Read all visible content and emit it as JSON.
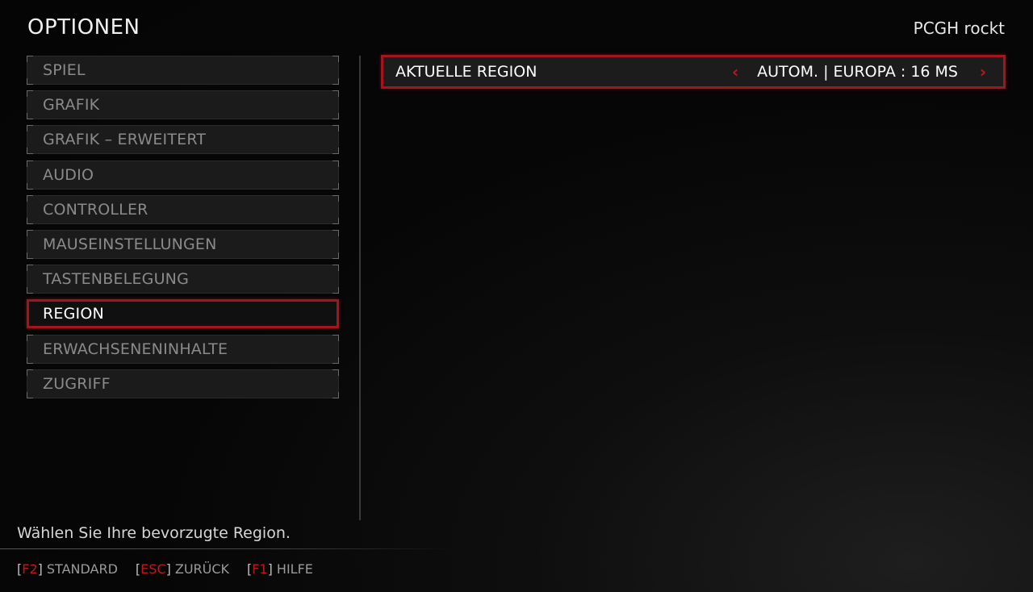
{
  "header": {
    "title": "OPTIONEN",
    "user": "PCGH rockt"
  },
  "menu": {
    "items": [
      {
        "label": "SPIEL",
        "active": false
      },
      {
        "label": "GRAFIK",
        "active": false
      },
      {
        "label": "GRAFIK – ERWEITERT",
        "active": false
      },
      {
        "label": "AUDIO",
        "active": false
      },
      {
        "label": "CONTROLLER",
        "active": false
      },
      {
        "label": "MAUSEINSTELLUNGEN",
        "active": false
      },
      {
        "label": "TASTENBELEGUNG",
        "active": false
      },
      {
        "label": "REGION",
        "active": true
      },
      {
        "label": "ERWACHSENENINHALTE",
        "active": false
      },
      {
        "label": "ZUGRIFF",
        "active": false
      }
    ]
  },
  "setting": {
    "label": "AKTUELLE REGION",
    "value": "AUTOM. | EUROPA : 16 MS",
    "left_arrow": "‹",
    "right_arrow": "›"
  },
  "hint": "Wählen Sie Ihre bevorzugte Region.",
  "footer": {
    "keys": [
      {
        "key": "F2",
        "label": "STANDARD"
      },
      {
        "key": "ESC",
        "label": "ZURÜCK"
      },
      {
        "key": "F1",
        "label": "HILFE"
      }
    ]
  },
  "colors": {
    "accent": "#a3141c",
    "text": "#ffffff",
    "muted": "#8a8a8a"
  }
}
